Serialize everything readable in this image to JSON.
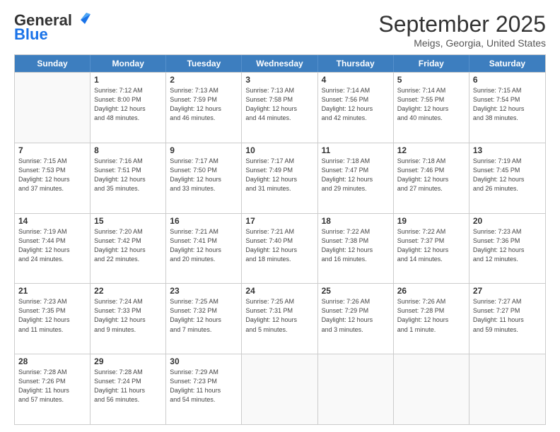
{
  "header": {
    "logo_line1": "General",
    "logo_line2": "Blue",
    "month": "September 2025",
    "location": "Meigs, Georgia, United States"
  },
  "days_of_week": [
    "Sunday",
    "Monday",
    "Tuesday",
    "Wednesday",
    "Thursday",
    "Friday",
    "Saturday"
  ],
  "weeks": [
    [
      {
        "day": "",
        "info": ""
      },
      {
        "day": "1",
        "info": "Sunrise: 7:12 AM\nSunset: 8:00 PM\nDaylight: 12 hours\nand 48 minutes."
      },
      {
        "day": "2",
        "info": "Sunrise: 7:13 AM\nSunset: 7:59 PM\nDaylight: 12 hours\nand 46 minutes."
      },
      {
        "day": "3",
        "info": "Sunrise: 7:13 AM\nSunset: 7:58 PM\nDaylight: 12 hours\nand 44 minutes."
      },
      {
        "day": "4",
        "info": "Sunrise: 7:14 AM\nSunset: 7:56 PM\nDaylight: 12 hours\nand 42 minutes."
      },
      {
        "day": "5",
        "info": "Sunrise: 7:14 AM\nSunset: 7:55 PM\nDaylight: 12 hours\nand 40 minutes."
      },
      {
        "day": "6",
        "info": "Sunrise: 7:15 AM\nSunset: 7:54 PM\nDaylight: 12 hours\nand 38 minutes."
      }
    ],
    [
      {
        "day": "7",
        "info": "Sunrise: 7:15 AM\nSunset: 7:53 PM\nDaylight: 12 hours\nand 37 minutes."
      },
      {
        "day": "8",
        "info": "Sunrise: 7:16 AM\nSunset: 7:51 PM\nDaylight: 12 hours\nand 35 minutes."
      },
      {
        "day": "9",
        "info": "Sunrise: 7:17 AM\nSunset: 7:50 PM\nDaylight: 12 hours\nand 33 minutes."
      },
      {
        "day": "10",
        "info": "Sunrise: 7:17 AM\nSunset: 7:49 PM\nDaylight: 12 hours\nand 31 minutes."
      },
      {
        "day": "11",
        "info": "Sunrise: 7:18 AM\nSunset: 7:47 PM\nDaylight: 12 hours\nand 29 minutes."
      },
      {
        "day": "12",
        "info": "Sunrise: 7:18 AM\nSunset: 7:46 PM\nDaylight: 12 hours\nand 27 minutes."
      },
      {
        "day": "13",
        "info": "Sunrise: 7:19 AM\nSunset: 7:45 PM\nDaylight: 12 hours\nand 26 minutes."
      }
    ],
    [
      {
        "day": "14",
        "info": "Sunrise: 7:19 AM\nSunset: 7:44 PM\nDaylight: 12 hours\nand 24 minutes."
      },
      {
        "day": "15",
        "info": "Sunrise: 7:20 AM\nSunset: 7:42 PM\nDaylight: 12 hours\nand 22 minutes."
      },
      {
        "day": "16",
        "info": "Sunrise: 7:21 AM\nSunset: 7:41 PM\nDaylight: 12 hours\nand 20 minutes."
      },
      {
        "day": "17",
        "info": "Sunrise: 7:21 AM\nSunset: 7:40 PM\nDaylight: 12 hours\nand 18 minutes."
      },
      {
        "day": "18",
        "info": "Sunrise: 7:22 AM\nSunset: 7:38 PM\nDaylight: 12 hours\nand 16 minutes."
      },
      {
        "day": "19",
        "info": "Sunrise: 7:22 AM\nSunset: 7:37 PM\nDaylight: 12 hours\nand 14 minutes."
      },
      {
        "day": "20",
        "info": "Sunrise: 7:23 AM\nSunset: 7:36 PM\nDaylight: 12 hours\nand 12 minutes."
      }
    ],
    [
      {
        "day": "21",
        "info": "Sunrise: 7:23 AM\nSunset: 7:35 PM\nDaylight: 12 hours\nand 11 minutes."
      },
      {
        "day": "22",
        "info": "Sunrise: 7:24 AM\nSunset: 7:33 PM\nDaylight: 12 hours\nand 9 minutes."
      },
      {
        "day": "23",
        "info": "Sunrise: 7:25 AM\nSunset: 7:32 PM\nDaylight: 12 hours\nand 7 minutes."
      },
      {
        "day": "24",
        "info": "Sunrise: 7:25 AM\nSunset: 7:31 PM\nDaylight: 12 hours\nand 5 minutes."
      },
      {
        "day": "25",
        "info": "Sunrise: 7:26 AM\nSunset: 7:29 PM\nDaylight: 12 hours\nand 3 minutes."
      },
      {
        "day": "26",
        "info": "Sunrise: 7:26 AM\nSunset: 7:28 PM\nDaylight: 12 hours\nand 1 minute."
      },
      {
        "day": "27",
        "info": "Sunrise: 7:27 AM\nSunset: 7:27 PM\nDaylight: 11 hours\nand 59 minutes."
      }
    ],
    [
      {
        "day": "28",
        "info": "Sunrise: 7:28 AM\nSunset: 7:26 PM\nDaylight: 11 hours\nand 57 minutes."
      },
      {
        "day": "29",
        "info": "Sunrise: 7:28 AM\nSunset: 7:24 PM\nDaylight: 11 hours\nand 56 minutes."
      },
      {
        "day": "30",
        "info": "Sunrise: 7:29 AM\nSunset: 7:23 PM\nDaylight: 11 hours\nand 54 minutes."
      },
      {
        "day": "",
        "info": ""
      },
      {
        "day": "",
        "info": ""
      },
      {
        "day": "",
        "info": ""
      },
      {
        "day": "",
        "info": ""
      }
    ]
  ]
}
